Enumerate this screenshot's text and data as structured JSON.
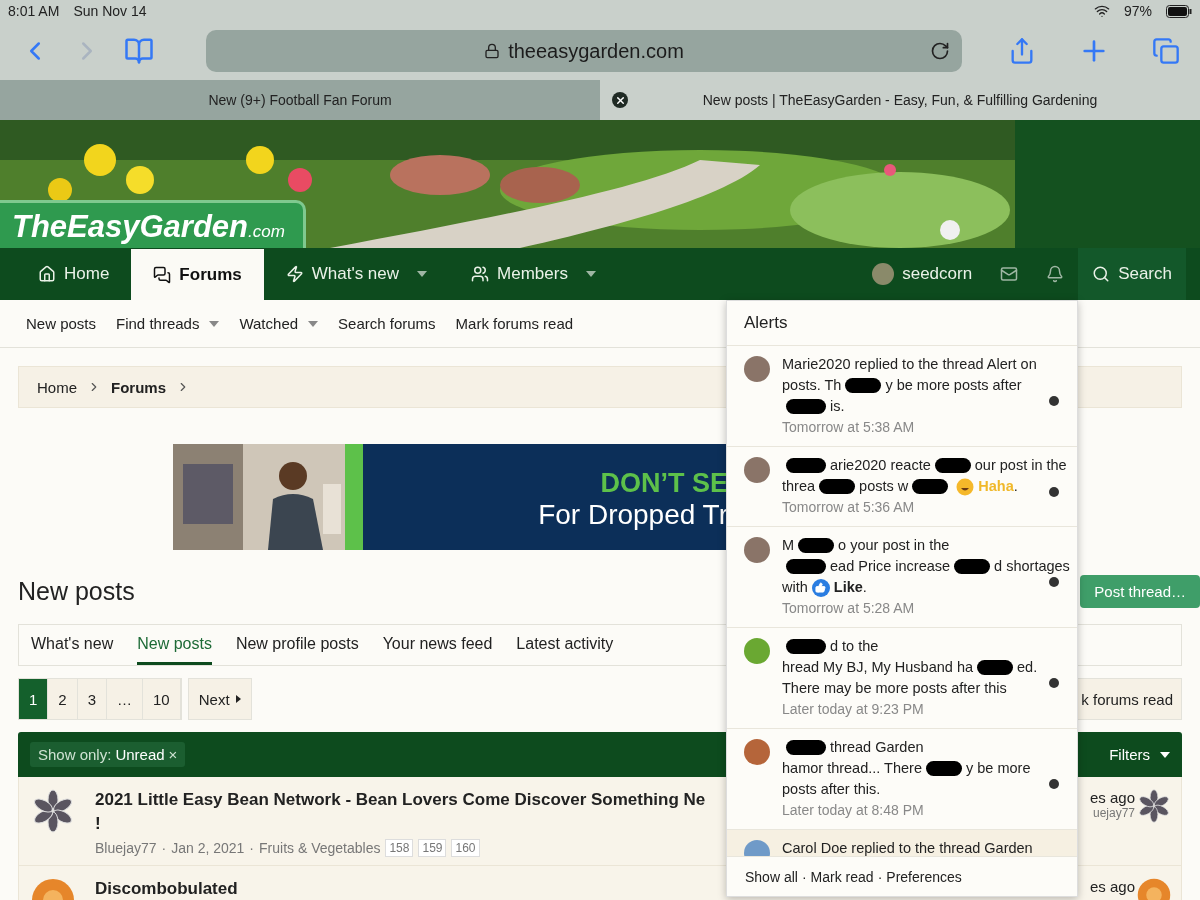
{
  "status_bar": {
    "time": "8:01 AM",
    "date": "Sun Nov 14",
    "battery": "97%"
  },
  "browser": {
    "url": "theeasygarden.com",
    "tabs": [
      {
        "title": "New (9+) Football Fan Forum",
        "selected": false
      },
      {
        "title": "New posts | TheEasyGarden - Easy, Fun, & Fulfilling Gardening",
        "selected": true
      }
    ]
  },
  "site": {
    "logo": "TheEasyGarden",
    "logo_suffix": ".com",
    "nav": [
      {
        "label": "Home",
        "selected": false,
        "dropdown": false
      },
      {
        "label": "Forums",
        "selected": true,
        "dropdown": false
      },
      {
        "label": "What's new",
        "selected": false,
        "dropdown": true
      },
      {
        "label": "Members",
        "selected": false,
        "dropdown": true
      }
    ],
    "user": "seedcorn",
    "search": "Search",
    "subnav": [
      {
        "label": "New posts",
        "dropdown": false
      },
      {
        "label": "Find threads",
        "dropdown": true
      },
      {
        "label": "Watched",
        "dropdown": true
      },
      {
        "label": "Search forums",
        "dropdown": false
      },
      {
        "label": "Mark forums read",
        "dropdown": false
      }
    ],
    "breadcrumb": [
      {
        "label": "Home",
        "current": false
      },
      {
        "label": "Forums",
        "current": true
      }
    ]
  },
  "ad": {
    "headline": "DON’T SE",
    "subline": "For Dropped Tr"
  },
  "page": {
    "title": "New posts",
    "post_button": "Post thread…",
    "tabs": [
      {
        "label": "What's new",
        "selected": false
      },
      {
        "label": "New posts",
        "selected": true
      },
      {
        "label": "New profile posts",
        "selected": false
      },
      {
        "label": "Your news feed",
        "selected": false
      },
      {
        "label": "Latest activity",
        "selected": false
      }
    ],
    "pages": [
      {
        "label": "1",
        "selected": true
      },
      {
        "label": "2",
        "selected": false
      },
      {
        "label": "3",
        "selected": false
      },
      {
        "label": "…",
        "selected": false
      },
      {
        "label": "10",
        "selected": false
      }
    ],
    "next": "Next",
    "mark_read": "k forums read",
    "filter": {
      "prefix": "Show only:",
      "value": "Unread",
      "remove": "×"
    },
    "filters_button": "Filters",
    "threads": [
      {
        "title_lines": [
          "2021 Little Easy Bean Network - Bean Lovers Come Discover Something Ne",
          "!"
        ],
        "author": "Bluejay77",
        "date": "Jan 2, 2021",
        "forum": "Fruits & Vegetables",
        "separator": "·",
        "pages": [
          "158",
          "159",
          "160"
        ],
        "right_time": "es ago",
        "right_user": "uejay77"
      },
      {
        "title_lines": [
          "Discombobulated"
        ],
        "right_time": "es ago"
      }
    ]
  },
  "alerts": {
    "title": "Alerts",
    "items": [
      {
        "lines": [
          {
            "parts": [
              "Marie2020 replied to the thread Alert on"
            ],
            "hidden_start": false,
            "hidden_end": false
          },
          {
            "parts": [
              "posts. Th",
              "y be more posts after"
            ],
            "hidden_start": false,
            "hidden_end": false
          },
          {
            "parts": [
              "is."
            ],
            "hidden_start": true,
            "hidden_end": false
          }
        ],
        "time": "Tomorrow at 5:38 AM",
        "unread": true
      },
      {
        "lines": [
          {
            "parts": [
              "arie2020 reacte",
              "our post in the"
            ],
            "hidden_start": true,
            "hidden_end": false
          },
          {
            "parts": [
              "threa",
              "posts w"
            ],
            "hidden_start": false,
            "hidden_end": true
          }
        ],
        "reaction": {
          "kind": "haha",
          "label": "Haha",
          "after": "."
        },
        "time": "Tomorrow at 5:36 AM",
        "unread": true
      },
      {
        "lines": [
          {
            "parts": [
              "M",
              "o your post in the"
            ],
            "hidden_start": false,
            "hidden_end": false
          },
          {
            "parts": [
              "ead Price increase",
              "d shortages"
            ],
            "hidden_start": true,
            "hidden_end": false
          },
          {
            "parts": [
              "with"
            ],
            "hidden_start": false,
            "hidden_end": false
          }
        ],
        "reaction": {
          "kind": "like",
          "label": "Like",
          "after": "."
        },
        "time": "Tomorrow at 5:28 AM",
        "unread": true
      },
      {
        "lines": [
          {
            "parts": [
              "d to the"
            ],
            "hidden_start": true,
            "hidden_end": false
          },
          {
            "parts": [
              "hread My BJ, My Husband ha",
              "ed."
            ],
            "hidden_start": false,
            "hidden_end": false
          },
          {
            "parts": [
              "There may be more posts after this"
            ],
            "hidden_start": false,
            "hidden_end": false
          }
        ],
        "time": "Later today at 9:23 PM",
        "unread": true
      },
      {
        "lines": [
          {
            "parts": [
              "thread Garden"
            ],
            "hidden_start": true,
            "hidden_end": false
          },
          {
            "parts": [
              "hamor thread... There",
              "y be more"
            ],
            "hidden_start": false,
            "hidden_end": false
          },
          {
            "parts": [
              "posts after this."
            ],
            "hidden_start": false,
            "hidden_end": false
          }
        ],
        "time": "Later today at 8:48 PM",
        "unread": true
      },
      {
        "lines": [
          {
            "parts": [
              "Carol Doe replied to the thread Garden"
            ],
            "hidden_start": false,
            "hidden_end": false
          }
        ],
        "unread": false
      }
    ],
    "footer": [
      "Show all",
      "Mark read",
      "Preferences"
    ],
    "footer_separator": "·"
  }
}
